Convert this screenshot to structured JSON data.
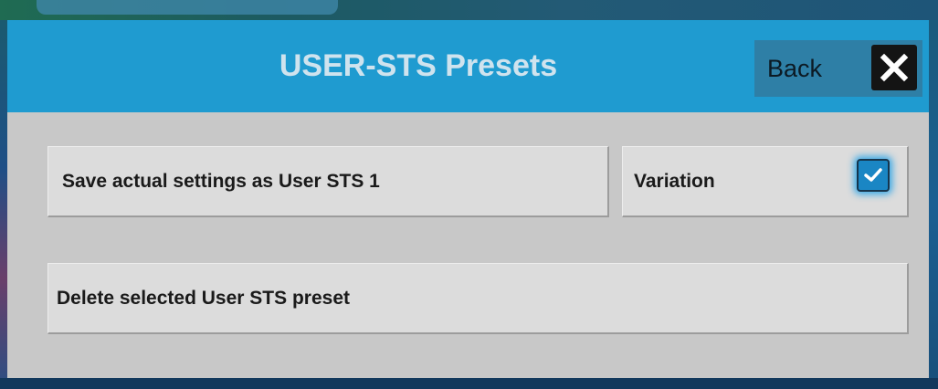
{
  "dialog": {
    "title": "USER-STS Presets",
    "back_label": "Back",
    "close_icon": "close-icon"
  },
  "actions": {
    "save_label": "Save actual settings as User STS 1",
    "variation_label": "Variation",
    "variation_checked": true,
    "delete_label": "Delete selected User STS preset"
  },
  "colors": {
    "header": "#1f9bd0",
    "panel": "#c8c8c8",
    "button": "#dcdcdc",
    "checkbox": "#1a86c4"
  }
}
